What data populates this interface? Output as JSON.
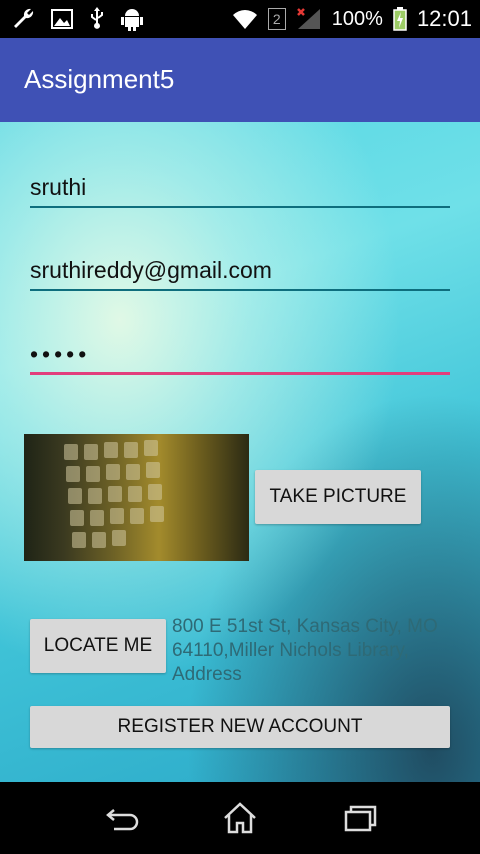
{
  "status_bar": {
    "icons_left": [
      "wrench-icon",
      "image-icon",
      "usb-icon",
      "android-icon"
    ],
    "icons_right": [
      "wifi-icon",
      "sim-2-icon",
      "signal-icon",
      "battery-charging-icon"
    ],
    "sim_label": "2",
    "battery": "100%",
    "time": "12:01"
  },
  "app_bar": {
    "title": "Assignment5"
  },
  "form": {
    "name_value": "sruthi",
    "email_value": "sruthireddy@gmail.com",
    "password_masked": "•••••",
    "take_picture_label": "TAKE PICTURE",
    "locate_me_label": "LOCATE ME",
    "address_text": "800 E 51st St, Kansas City, MO 64110,Miller Nichols Library, Address",
    "register_label": "REGISTER NEW ACCOUNT"
  },
  "nav_bar": {
    "icons": [
      "back-icon",
      "home-icon",
      "recents-icon"
    ]
  },
  "colors": {
    "app_bar": "#3f51b5",
    "field_underline": "#0e6e7d",
    "focus_underline": "#e23e7c",
    "button": "#d8d8d8"
  }
}
